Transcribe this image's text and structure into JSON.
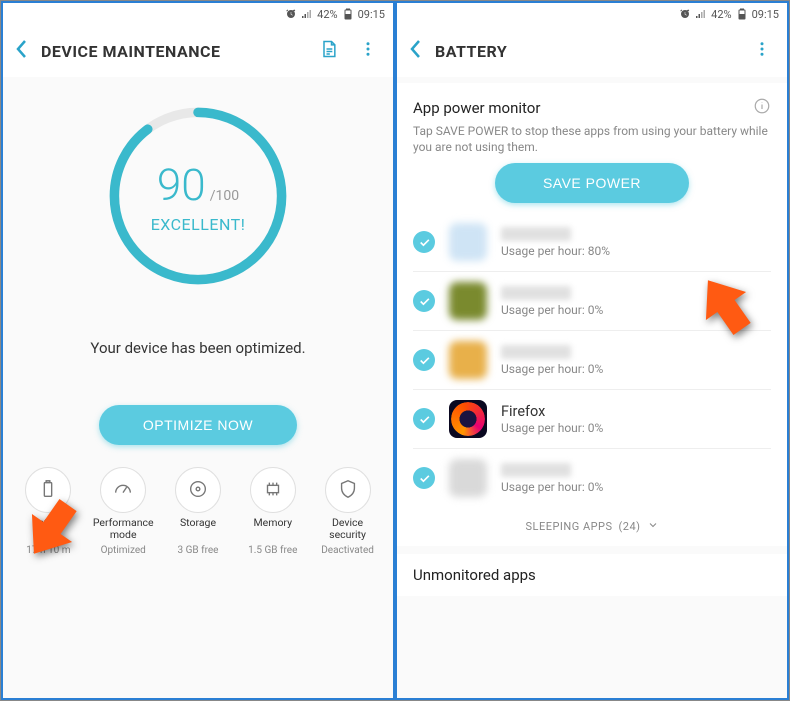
{
  "statusbar": {
    "battery_pct": "42%",
    "time": "09:15"
  },
  "left": {
    "title": "DEVICE MAINTENANCE",
    "score": "90",
    "score_total": "/100",
    "score_label": "EXCELLENT!",
    "optimized_msg": "Your device has been optimized.",
    "optimize_btn": "OPTIMIZE NOW",
    "cats": [
      {
        "label": "Battery",
        "sub": "17 h 10 m"
      },
      {
        "label": "Performance mode",
        "sub": "Optimized"
      },
      {
        "label": "Storage",
        "sub": "3 GB free"
      },
      {
        "label": "Memory",
        "sub": "1.5 GB free"
      },
      {
        "label": "Device security",
        "sub": "Deactivated"
      }
    ]
  },
  "right": {
    "title": "BATTERY",
    "section_title": "App power monitor",
    "section_sub": "Tap SAVE POWER to stop these apps from using your battery while you are not using them.",
    "save_btn": "SAVE POWER",
    "usage_prefix": "Usage per hour: ",
    "apps": [
      {
        "name_hidden": true,
        "usage": "80%",
        "icon_color": "#cfe4f5"
      },
      {
        "name_hidden": true,
        "usage": "0%",
        "icon_color": "#7a8a2e"
      },
      {
        "name_hidden": true,
        "usage": "0%",
        "icon_color": "#e8b04a"
      },
      {
        "name": "Firefox",
        "usage": "0%",
        "firefox": true
      },
      {
        "name_hidden": true,
        "usage": "0%",
        "icon_color": "#d9d9d9"
      }
    ],
    "sleeping_label": "SLEEPING APPS",
    "sleeping_count": "(24)",
    "unmon_title": "Unmonitored apps"
  }
}
